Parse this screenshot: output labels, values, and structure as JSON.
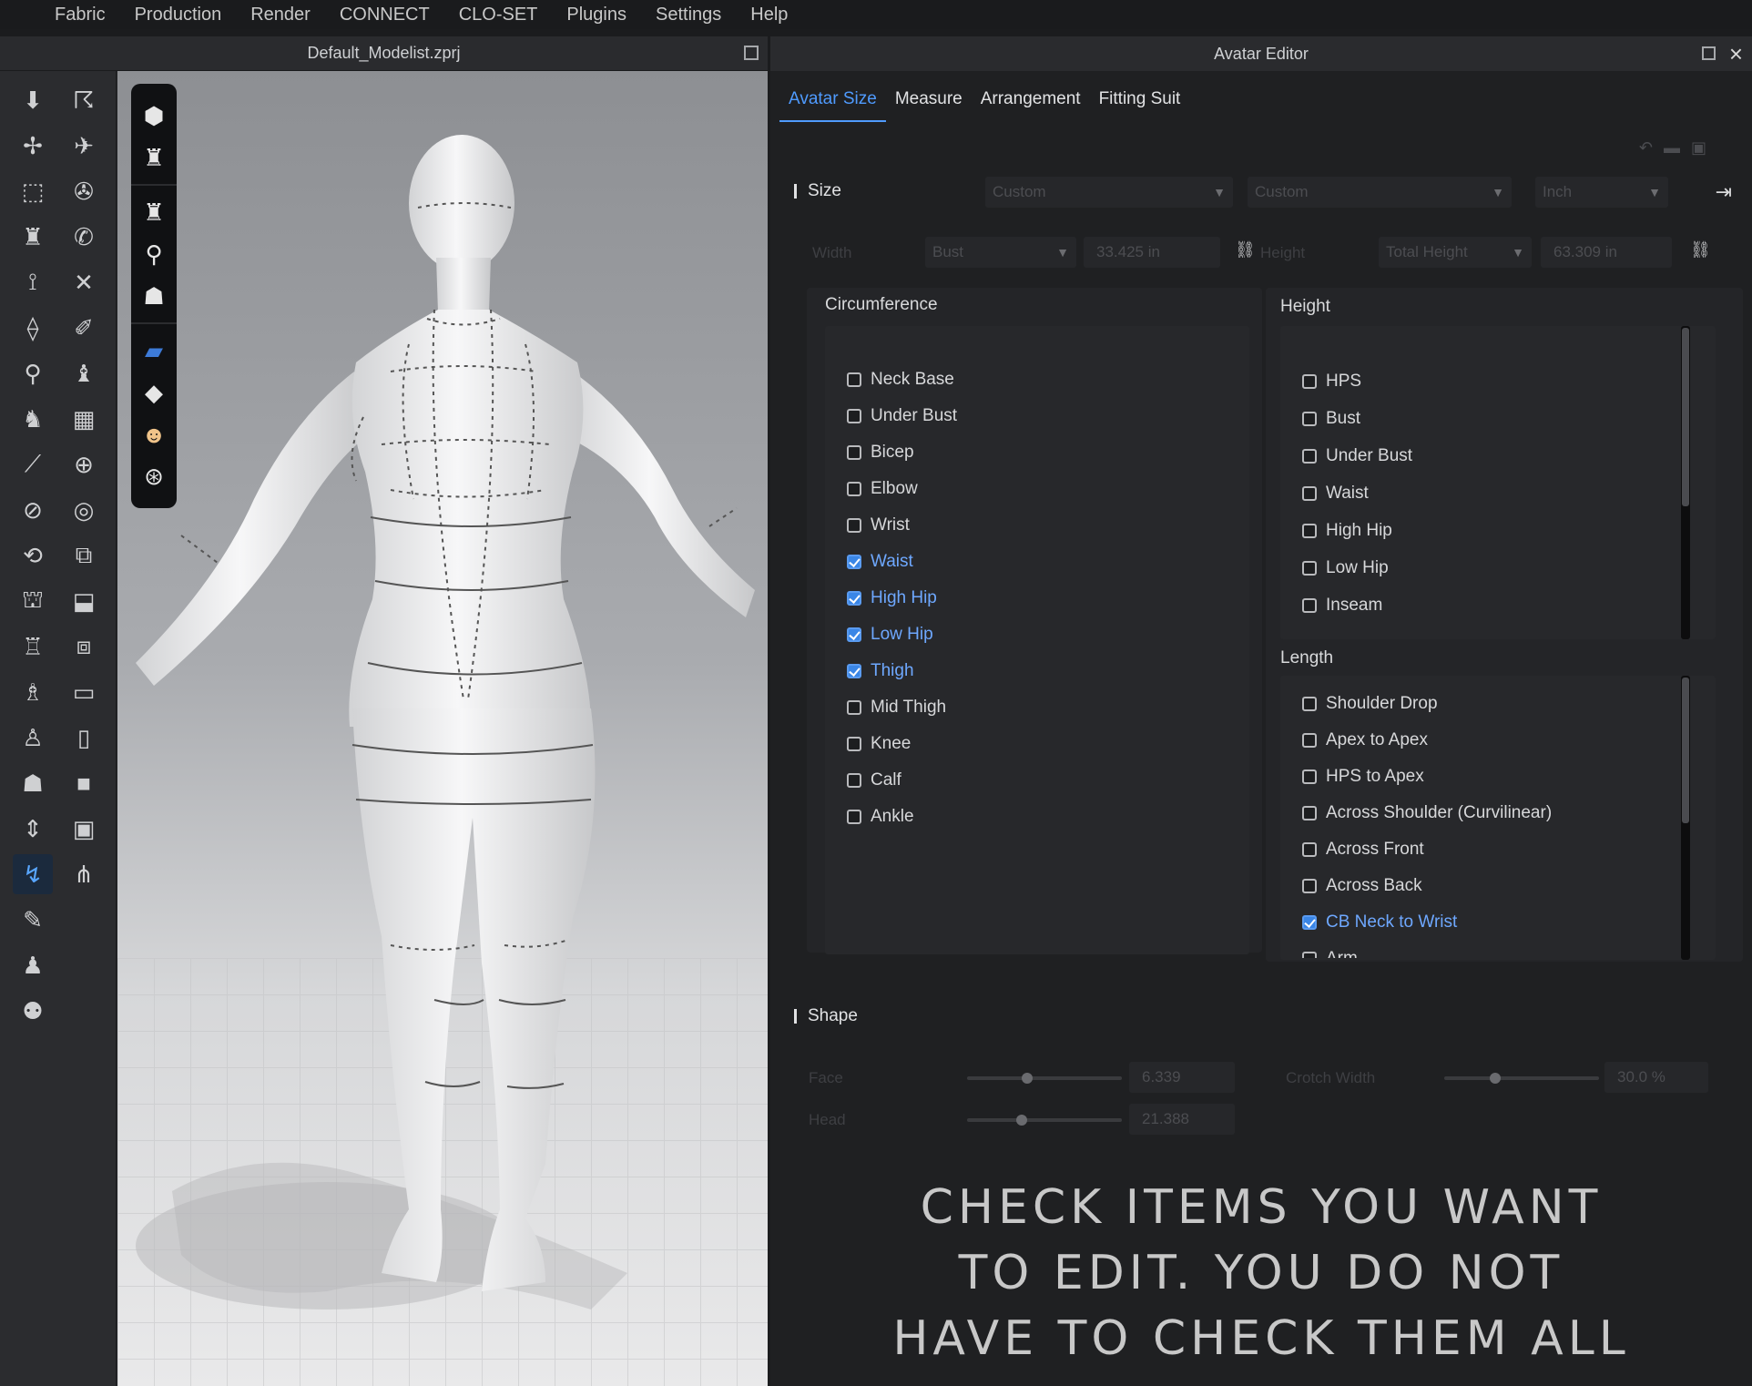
{
  "menubar": {
    "items": [
      "Fabric",
      "Production",
      "Render",
      "CONNECT",
      "CLO-SET",
      "Plugins",
      "Settings",
      "Help"
    ]
  },
  "viewport": {
    "title": "Default_Modelist.zprj"
  },
  "editor": {
    "title": "Avatar Editor",
    "close_label": "×",
    "tabs": [
      "Avatar Size",
      "Measure",
      "Arrangement",
      "Fitting Suit"
    ],
    "active_tab": "Avatar Size",
    "size_section": {
      "label": "Size",
      "dropdown1": "Custom",
      "dropdown2": "Custom",
      "unit": "Inch",
      "width_label": "Width",
      "width_type": "Bust",
      "width_value": "33.425 in",
      "height_label": "Height",
      "height_type": "Total Height",
      "height_value": "63.309 in"
    },
    "circumference": {
      "title": "Circumference",
      "items": [
        {
          "label": "Neck Base",
          "checked": false
        },
        {
          "label": "Under Bust",
          "checked": false
        },
        {
          "label": "Bicep",
          "checked": false
        },
        {
          "label": "Elbow",
          "checked": false
        },
        {
          "label": "Wrist",
          "checked": false
        },
        {
          "label": "Waist",
          "checked": true
        },
        {
          "label": "High Hip",
          "checked": true
        },
        {
          "label": "Low Hip",
          "checked": true
        },
        {
          "label": "Thigh",
          "checked": true
        },
        {
          "label": "Mid Thigh",
          "checked": false
        },
        {
          "label": "Knee",
          "checked": false
        },
        {
          "label": "Calf",
          "checked": false
        },
        {
          "label": "Ankle",
          "checked": false
        }
      ]
    },
    "height": {
      "title": "Height",
      "items": [
        {
          "label": "HPS",
          "checked": false
        },
        {
          "label": "Bust",
          "checked": false
        },
        {
          "label": "Under Bust",
          "checked": false
        },
        {
          "label": "Waist",
          "checked": false
        },
        {
          "label": "High Hip",
          "checked": false
        },
        {
          "label": "Low Hip",
          "checked": false
        },
        {
          "label": "Inseam",
          "checked": false
        }
      ]
    },
    "length": {
      "title": "Length",
      "items": [
        {
          "label": "Shoulder Drop",
          "checked": false
        },
        {
          "label": "Apex to Apex",
          "checked": false
        },
        {
          "label": "HPS to Apex",
          "checked": false
        },
        {
          "label": "Across Shoulder (Curvilinear)",
          "checked": false
        },
        {
          "label": "Across Front",
          "checked": false
        },
        {
          "label": "Across Back",
          "checked": false
        },
        {
          "label": "CB Neck to Wrist",
          "checked": true
        },
        {
          "label": "Arm",
          "checked": false
        }
      ]
    },
    "shape_section": {
      "label": "Shape",
      "row1_label": "Face",
      "row1_value": "6.339",
      "row2_label": "Head",
      "row2_value": "21.388",
      "crotch_label": "Crotch Width",
      "crotch_value": "30.0 %"
    }
  },
  "caption": {
    "line1": "CHECK ITEMS YOU WANT",
    "line2": "TO EDIT. YOU DO NOT",
    "line3": "HAVE TO CHECK THEM ALL"
  },
  "colors": {
    "accent": "#4f9bff",
    "checked_text": "#6ea8ff",
    "panel_bg": "#242528"
  }
}
